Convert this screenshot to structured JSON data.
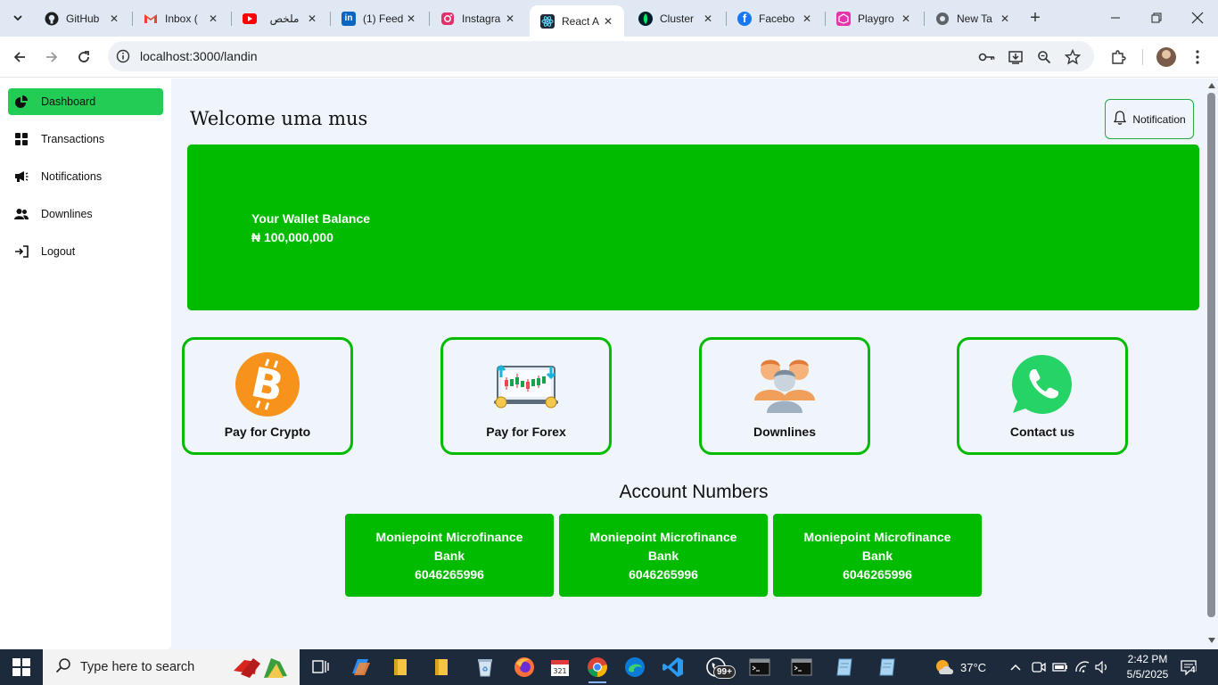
{
  "browser": {
    "tabs": [
      {
        "title": "GitHub",
        "icon": "github-icon",
        "color": "#1f1f1f"
      },
      {
        "title": "Inbox (",
        "icon": "gmail-icon",
        "color": "#ea4335"
      },
      {
        "title": "ملخص",
        "icon": "youtube-icon",
        "color": "#ff0000"
      },
      {
        "title": "(1) Feed",
        "icon": "linkedin-icon",
        "color": "#0a66c2"
      },
      {
        "title": "Instagra",
        "icon": "instagram-icon",
        "color": "#e1306c"
      },
      {
        "title": "React A",
        "icon": "react-icon",
        "color": "#1f2937",
        "active": true
      },
      {
        "title": "Cluster",
        "icon": "mongodb-icon",
        "color": "#001e2b"
      },
      {
        "title": "Facebo",
        "icon": "facebook-icon",
        "color": "#1877f2"
      },
      {
        "title": "Playgro",
        "icon": "playground-icon",
        "color": "#e535ab"
      },
      {
        "title": "New Ta",
        "icon": "chrome-icon",
        "color": "#5f6368"
      }
    ],
    "url": "localhost:3000/landin"
  },
  "sidebar": {
    "items": [
      {
        "label": "Dashboard",
        "icon": "pie-chart-icon",
        "active": true
      },
      {
        "label": "Transactions",
        "icon": "grid-icon"
      },
      {
        "label": "Notifications",
        "icon": "megaphone-icon"
      },
      {
        "label": "Downlines",
        "icon": "users-icon"
      },
      {
        "label": "Logout",
        "icon": "logout-icon"
      }
    ]
  },
  "main": {
    "welcome": "Welcome uma mus",
    "notification_button": "Notification",
    "wallet": {
      "label": "Your Wallet Balance",
      "amount": "₦ 100,000,000"
    },
    "actions": [
      {
        "label": "Pay for Crypto",
        "icon": "bitcoin-icon"
      },
      {
        "label": "Pay for Forex",
        "icon": "forex-chart-icon"
      },
      {
        "label": "Downlines",
        "icon": "team-icon"
      },
      {
        "label": "Contact us",
        "icon": "whatsapp-icon"
      }
    ],
    "accounts_title": "Account Numbers",
    "accounts": [
      {
        "bank": "Moniepoint Microfinance Bank",
        "number": "6046265996"
      },
      {
        "bank": "Moniepoint Microfinance Bank",
        "number": "6046265996"
      },
      {
        "bank": "Moniepoint Microfinance Bank",
        "number": "6046265996"
      }
    ]
  },
  "taskbar": {
    "search_placeholder": "Type here to search",
    "whatsapp_badge": "99+",
    "temperature": "37°C",
    "time": "2:42 PM",
    "date": "5/5/2025",
    "notification_count": "4"
  },
  "colors": {
    "accent_green": "#00bb00",
    "active_nav": "#22cc55",
    "page_bg": "#f0f5fc"
  }
}
